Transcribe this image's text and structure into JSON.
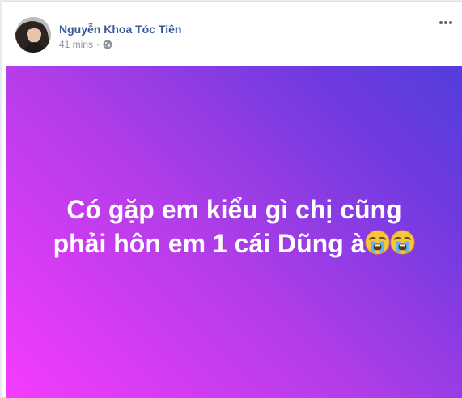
{
  "post": {
    "author_name": "Nguyễn Khoa Tóc Tiên",
    "timestamp": "41 mins",
    "separator": "·",
    "privacy_icon": "globe-icon",
    "more_icon": "more-options-icon",
    "text_line_1": "Có gặp em kiểu gì chị cũng",
    "text_line_2": "phải hôn em 1 cái Dũng à",
    "emojis": [
      "loudly-crying-face-icon",
      "loudly-crying-face-icon"
    ]
  },
  "colors": {
    "author_link": "#365899",
    "meta_text": "#90949c",
    "gradient_start": "#f53bff",
    "gradient_end": "#533ddb",
    "post_text": "#ffffff"
  }
}
